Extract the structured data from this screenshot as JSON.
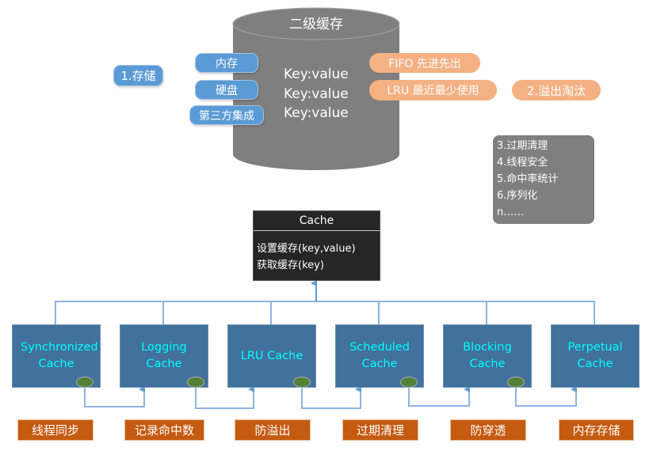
{
  "cylinder": {
    "title": "二级缓存",
    "entries": [
      "Key:value",
      "Key:value",
      "Key:value"
    ]
  },
  "storage": {
    "label": "1.存储",
    "items": [
      "内存",
      "硬盘",
      "第三方集成"
    ]
  },
  "eviction": {
    "label": "2.溢出淘汰",
    "items": [
      "FIFO 先进先出",
      "LRU 最近最少使用"
    ]
  },
  "notes": [
    "3.过期清理",
    "4.线程安全",
    "5.命中率统计",
    "6.序列化",
    "n……"
  ],
  "cache_interface": {
    "title": "Cache",
    "methods": [
      "设置缓存(key,value)",
      "获取缓存(key)"
    ]
  },
  "implementations": [
    {
      "name": "Synchronized Cache",
      "feature": "线程同步"
    },
    {
      "name": "Logging Cache",
      "feature": "记录命中数"
    },
    {
      "name": "LRU Cache",
      "feature": "防溢出"
    },
    {
      "name": "Scheduled Cache",
      "feature": "过期清理"
    },
    {
      "name": "Blocking Cache",
      "feature": "防穿透"
    },
    {
      "name": "Perpetual Cache",
      "feature": "内存存储"
    }
  ],
  "colors": {
    "blue": "#5b9bd5",
    "orange": "#f4b183",
    "impl": "#41719c",
    "label": "#c55a11",
    "cylinder": "#7f7f7f"
  }
}
